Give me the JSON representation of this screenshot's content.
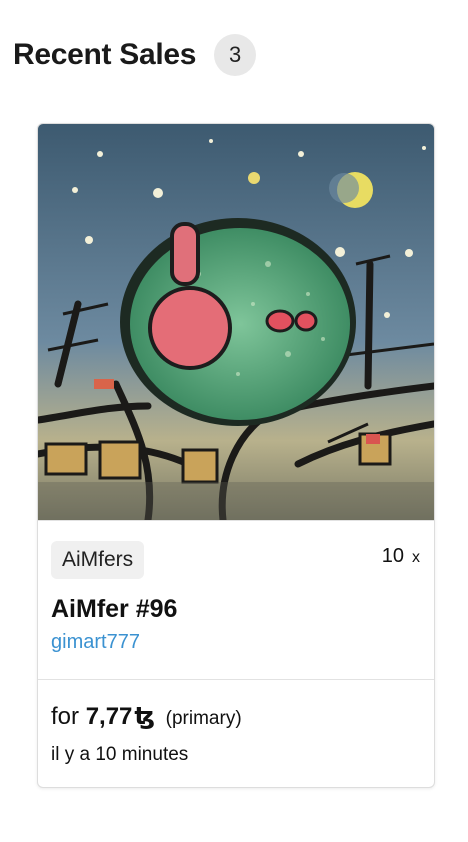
{
  "section": {
    "title": "Recent Sales",
    "count": "3"
  },
  "sale": {
    "artwork_alt": "AiMfer #96",
    "collection": "AiMfers",
    "edition_count": "10",
    "edition_mark": "x",
    "token_name": "AiMfer #96",
    "creator": "gimart777",
    "price_prefix": "for",
    "price_amount": "7,77",
    "price_currency": "ꜩ",
    "sale_type": "(primary)",
    "time_ago": "il y a 10 minutes"
  },
  "colors": {
    "link": "#3b92d1",
    "badge_bg": "#e8e8e8",
    "tag_bg": "#f0f0f0"
  }
}
